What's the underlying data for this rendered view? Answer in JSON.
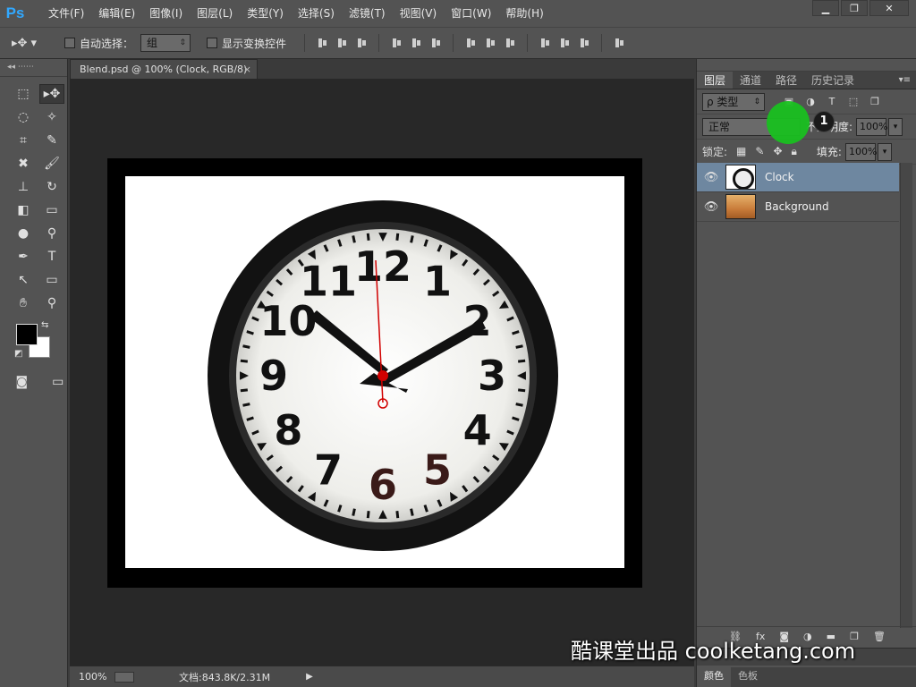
{
  "app": {
    "logo": "Ps",
    "menu": [
      "文件(F)",
      "编辑(E)",
      "图像(I)",
      "图层(L)",
      "类型(Y)",
      "选择(S)",
      "滤镜(T)",
      "视图(V)",
      "窗口(W)",
      "帮助(H)"
    ],
    "window_buttons": [
      "▁",
      "❐",
      "✕"
    ]
  },
  "options": {
    "tool_icon": "move-tool-icon",
    "auto_select_label": "自动选择：",
    "auto_select_value": "组",
    "show_transform_label": "显示变换控件"
  },
  "document": {
    "tab_title": "Blend.psd @ 100% (Clock, RGB/8)",
    "tab_close": "×",
    "clock_numbers": [
      "12",
      "1",
      "2",
      "3",
      "4",
      "5",
      "6",
      "7",
      "8",
      "9",
      "10",
      "11"
    ]
  },
  "status": {
    "zoom": "100%",
    "doc_info": "文档:843.8K/2.31M"
  },
  "layers_panel": {
    "tabs": [
      "图层",
      "通道",
      "路径",
      "历史记录"
    ],
    "active_tab": "图层",
    "kind_filter": "ρ 类型",
    "blend_mode": "正常",
    "opacity_label": "不透明度:",
    "opacity_value": "100%",
    "lock_label": "锁定:",
    "fill_label": "填充:",
    "fill_value": "100%",
    "layers": [
      {
        "name": "Clock",
        "selected": true,
        "visible": true
      },
      {
        "name": "Background",
        "selected": false,
        "visible": true
      }
    ],
    "bottom_tabs": [
      "颜色",
      "色板"
    ]
  },
  "overlay": {
    "step_badge": "1",
    "watermark": "酷课堂出品 coolketang.com"
  },
  "colors": {
    "accent_selected_layer": "#6e87a0",
    "click_marker": "#19c020",
    "ps_logo": "#31a8ff"
  }
}
